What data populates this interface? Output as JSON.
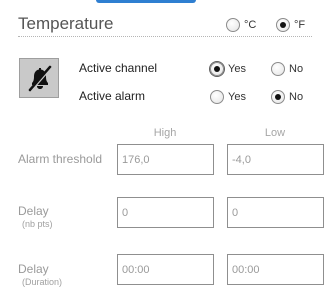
{
  "temperature": {
    "title": "Temperature",
    "unit_options": [
      {
        "label": "°C",
        "checked": false
      },
      {
        "label": "°F",
        "checked": true
      }
    ]
  },
  "channel": {
    "icon": "bell-muted-icon",
    "active_channel_label": "Active channel",
    "active_channel_yes": "Yes",
    "active_channel_no": "No",
    "active_channel_value": "Yes",
    "active_alarm_label": "Active alarm",
    "active_alarm_yes": "Yes",
    "active_alarm_no": "No",
    "active_alarm_value": "No"
  },
  "thresholds": {
    "high_header": "High",
    "low_header": "Low",
    "rows": [
      {
        "label": "Alarm threshold",
        "sublabel": "",
        "high": "176,0",
        "low": "-4,0"
      },
      {
        "label": "Delay",
        "sublabel": "(nb pts)",
        "high": "0",
        "low": "0"
      },
      {
        "label": "Delay",
        "sublabel": "(Duration)",
        "high": "00:00",
        "low": "00:00"
      }
    ]
  },
  "colors": {
    "accent": "#2f7fd1",
    "icon_box": "#c9c9c9",
    "field_border": "#8f8f8f"
  }
}
